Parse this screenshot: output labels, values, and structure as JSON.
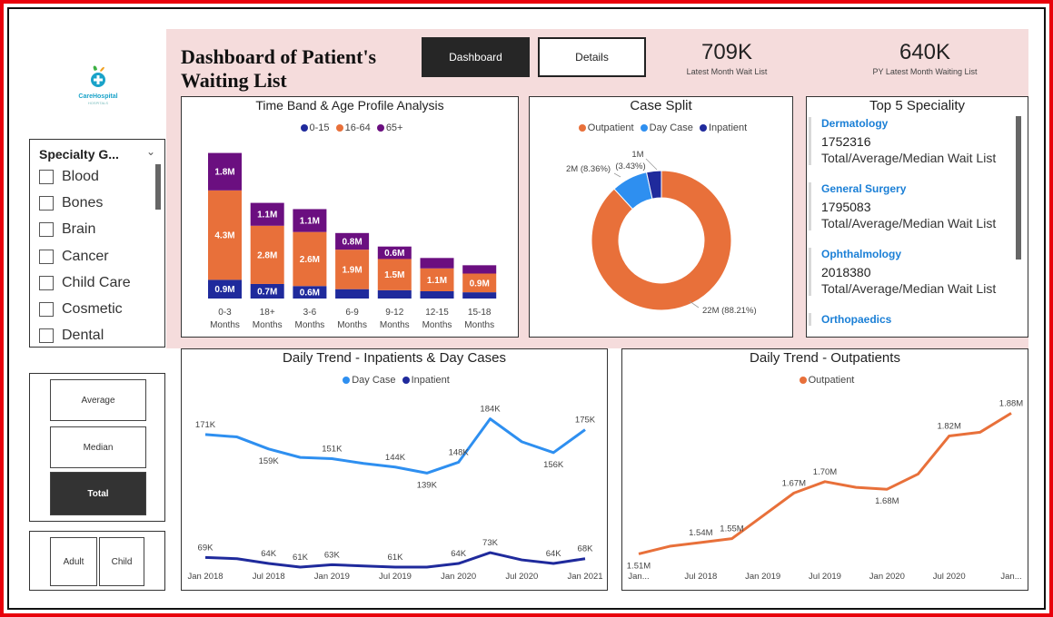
{
  "logo": {
    "name": "CareHospital",
    "sub": "HOSPITALS"
  },
  "title": "Dashboard of Patient's Waiting List",
  "nav": {
    "dashboard": "Dashboard",
    "details": "Details"
  },
  "kpis": [
    {
      "value": "709K",
      "label": "Latest Month Wait List"
    },
    {
      "value": "640K",
      "label": "PY Latest Month Waiting List"
    }
  ],
  "slicer": {
    "title": "Specialty G...",
    "items": [
      "Blood",
      "Bones",
      "Brain",
      "Cancer",
      "Child Care",
      "Cosmetic",
      "Dental"
    ]
  },
  "measure_buttons": {
    "average": "Average",
    "median": "Median",
    "total": "Total",
    "selected": "Total"
  },
  "age_buttons": {
    "adult": "Adult",
    "child": "Child"
  },
  "colors": {
    "age_0_15": "#1f2a9c",
    "age_16_64": "#e8703a",
    "age_65_plus": "#6b0f80",
    "day_case": "#2e8ff0",
    "inpatient": "#1f2a9c",
    "outpatient": "#e8703a",
    "spec_link": "#1a7fd6",
    "accent_red": "#e8000b"
  },
  "charts": {
    "time_band": {
      "title": "Time Band & Age Profile Analysis",
      "legend": [
        "0-15",
        "16-64",
        "65+"
      ]
    },
    "case_split": {
      "title": "Case Split",
      "legend": [
        "Outpatient",
        "Day Case",
        "Inpatient"
      ]
    },
    "top5": {
      "title": "Top 5 Speciality",
      "items": [
        {
          "name": "Dermatology",
          "value": "1752316",
          "label": "Total/Average/Median Wait List"
        },
        {
          "name": "General Surgery",
          "value": "1795083",
          "label": "Total/Average/Median Wait List"
        },
        {
          "name": "Ophthalmology",
          "value": "2018380",
          "label": "Total/Average/Median Wait List"
        },
        {
          "name": "Orthopaedics",
          "value": "",
          "label": ""
        }
      ]
    },
    "daily_ip": {
      "title": "Daily Trend - Inpatients & Day Cases",
      "legend": [
        "Day Case",
        "Inpatient"
      ]
    },
    "daily_op": {
      "title": "Daily Trend - Outpatients",
      "legend": [
        "Outpatient"
      ]
    }
  },
  "chart_data": [
    {
      "type": "bar",
      "stacked": true,
      "title": "Time Band & Age Profile Analysis",
      "categories": [
        "0-3 Months",
        "18+ Months",
        "3-6 Months",
        "6-9 Months",
        "9-12 Months",
        "12-15 Months",
        "15-18 Months"
      ],
      "series": [
        {
          "name": "0-15",
          "values": [
            0.9,
            0.7,
            0.6,
            0.45,
            0.4,
            0.35,
            0.3
          ],
          "labels": [
            "0.9M",
            "0.7M",
            "0.6M",
            "",
            "",
            "",
            ""
          ]
        },
        {
          "name": "16-64",
          "values": [
            4.3,
            2.8,
            2.6,
            1.9,
            1.5,
            1.1,
            0.9
          ],
          "labels": [
            "4.3M",
            "2.8M",
            "2.6M",
            "1.9M",
            "1.5M",
            "1.1M",
            "0.9M"
          ]
        },
        {
          "name": "65+",
          "values": [
            1.8,
            1.1,
            1.1,
            0.8,
            0.6,
            0.5,
            0.4
          ],
          "labels": [
            "1.8M",
            "1.1M",
            "1.1M",
            "0.8M",
            "0.6M",
            "",
            ""
          ]
        }
      ],
      "ylim": [
        0,
        7.2
      ]
    },
    {
      "type": "pie",
      "donut": true,
      "title": "Case Split",
      "categories": [
        "Outpatient",
        "Day Case",
        "Inpatient"
      ],
      "values": [
        88.21,
        8.36,
        3.43
      ],
      "labels": [
        "22M (88.21%)",
        "2M (8.36%)",
        "1M (3.43%)"
      ]
    },
    {
      "type": "line",
      "title": "Daily Trend - Inpatients & Day Cases",
      "x": [
        "2018-01",
        "2018-04",
        "2018-07",
        "2018-10",
        "2019-01",
        "2019-04",
        "2019-07",
        "2019-10",
        "2020-01",
        "2020-04",
        "2020-07",
        "2020-10",
        "2021-01"
      ],
      "x_ticks": [
        "Jan 2018",
        "Jul 2018",
        "Jan 2019",
        "Jul 2019",
        "Jan 2020",
        "Jul 2020",
        "Jan 2021"
      ],
      "series": [
        {
          "name": "Day Case",
          "values": [
            171,
            169,
            159,
            152,
            151,
            147,
            144,
            139,
            148,
            184,
            165,
            156,
            175
          ],
          "labels": [
            "171K",
            "",
            "159K",
            "",
            "151K",
            "",
            "144K",
            "139K",
            "148K",
            "184K",
            "",
            "156K",
            "175K"
          ]
        },
        {
          "name": "Inpatient",
          "values": [
            69,
            68,
            64,
            61,
            63,
            62,
            61,
            61,
            64,
            73,
            67,
            64,
            68
          ],
          "labels": [
            "69K",
            "",
            "64K",
            "61K",
            "63K",
            "",
            "61K",
            "",
            "64K",
            "73K",
            "",
            "64K",
            "68K"
          ]
        }
      ],
      "ylim": [
        55,
        195
      ]
    },
    {
      "type": "line",
      "title": "Daily Trend - Outpatients",
      "x": [
        "2018-01",
        "2018-04",
        "2018-07",
        "2018-10",
        "2019-01",
        "2019-04",
        "2019-07",
        "2019-10",
        "2020-01",
        "2020-04",
        "2020-07",
        "2020-10",
        "2021-01"
      ],
      "x_ticks": [
        "Jan...",
        "Jul 2018",
        "Jan 2019",
        "Jul 2019",
        "Jan 2020",
        "Jul 2020",
        "Jan..."
      ],
      "series": [
        {
          "name": "Outpatient",
          "values": [
            1.51,
            1.53,
            1.54,
            1.55,
            1.61,
            1.67,
            1.7,
            1.685,
            1.68,
            1.72,
            1.82,
            1.83,
            1.88
          ],
          "labels": [
            "1.51M",
            "",
            "1.54M",
            "1.55M",
            "",
            "1.67M",
            "1.70M",
            "",
            "1.68M",
            "",
            "1.82M",
            "",
            "1.88M"
          ]
        }
      ],
      "ylim": [
        1.48,
        1.9
      ]
    }
  ]
}
